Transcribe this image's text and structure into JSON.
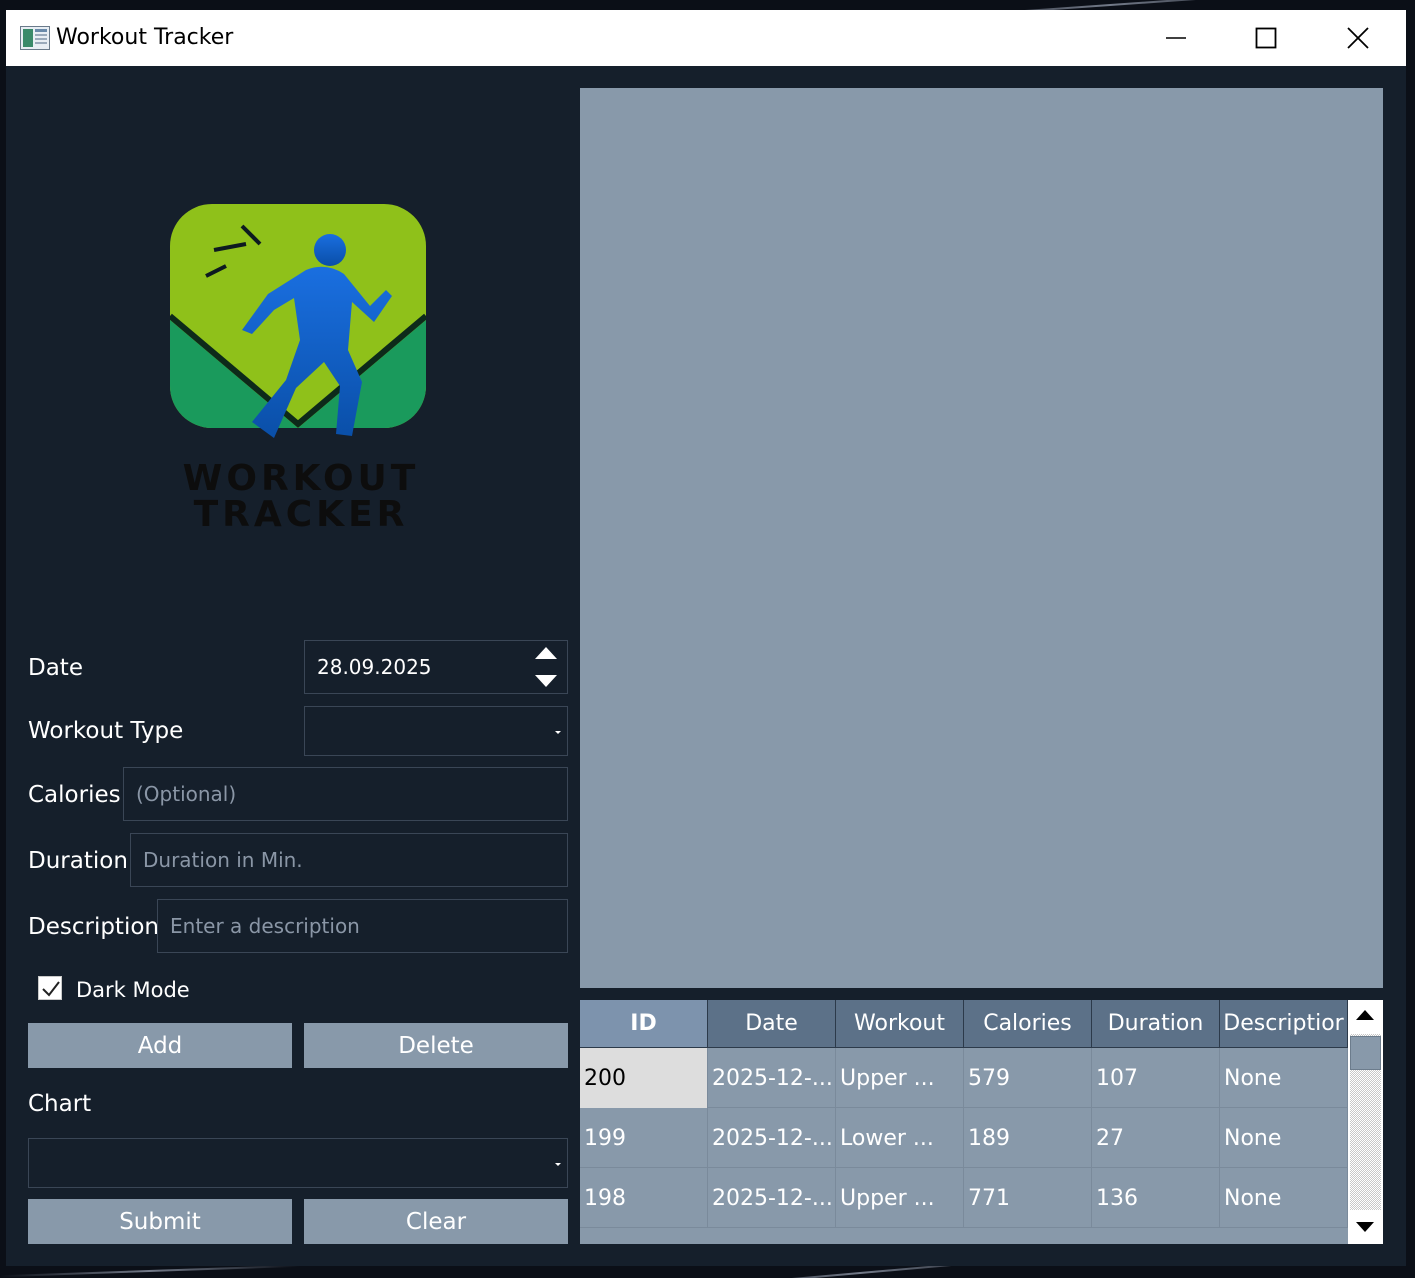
{
  "window": {
    "title": "Workout Tracker",
    "controls": [
      "minimize",
      "maximize",
      "close"
    ]
  },
  "logo": {
    "line1": "WORKOUT",
    "line2": "TRACKER",
    "colors": {
      "top": "#8fc11a",
      "bottom": "#1a9a5c",
      "runner": "#0b5fd0",
      "text": "#0d0d0d"
    }
  },
  "form": {
    "date_label": "Date",
    "date_value": "28.09.2025",
    "workout_type_label": "Workout Type",
    "workout_type_value": "",
    "calories_label": "Calories",
    "calories_placeholder": "(Optional)",
    "duration_label": "Duration",
    "duration_placeholder": "Duration in Min.",
    "description_label": "Description",
    "description_placeholder": "Enter a description",
    "dark_mode_label": "Dark Mode",
    "dark_mode_checked": true,
    "add_label": "Add",
    "delete_label": "Delete",
    "chart_label": "Chart",
    "chart_value": "",
    "submit_label": "Submit",
    "clear_label": "Clear"
  },
  "table": {
    "columns": [
      "ID",
      "Date",
      "Workout",
      "Calories",
      "Duration",
      "Descriptior"
    ],
    "rows": [
      [
        "200",
        "2025-12-...",
        "Upper ...",
        "579",
        "107",
        "None"
      ],
      [
        "199",
        "2025-12-...",
        "Lower ...",
        "189",
        "27",
        "None"
      ],
      [
        "198",
        "2025-12-...",
        "Upper ...",
        "771",
        "136",
        "None"
      ]
    ],
    "selected_row": 0
  },
  "colors": {
    "window_bg": "#151f2b",
    "accent": "#8899aa",
    "header": "#5c7188"
  }
}
